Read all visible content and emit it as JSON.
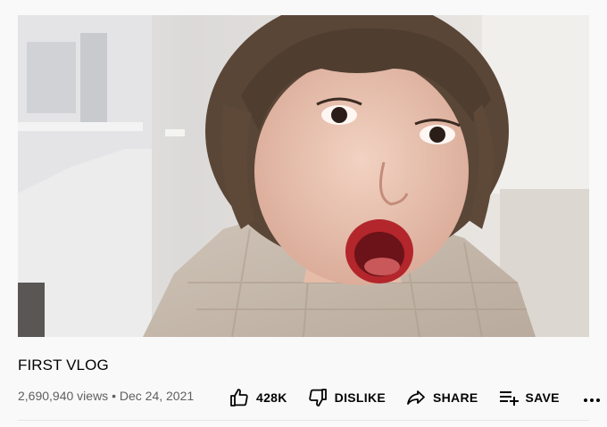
{
  "video": {
    "title": "FIRST VLOG",
    "views": "2,690,940 views",
    "separator": "•",
    "date": "Dec 24, 2021"
  },
  "actions": {
    "like_count": "428K",
    "dislike_label": "DISLIKE",
    "share_label": "SHARE",
    "save_label": "SAVE"
  },
  "icons": {
    "like": "thumb-up-icon",
    "dislike": "thumb-down-icon",
    "share": "share-arrow-icon",
    "save": "playlist-add-icon",
    "more": "more-horizontal-icon"
  },
  "colors": {
    "background": "#f9f9f9",
    "text_primary": "#030303",
    "text_secondary": "#606060",
    "divider": "#e5e5e5"
  }
}
